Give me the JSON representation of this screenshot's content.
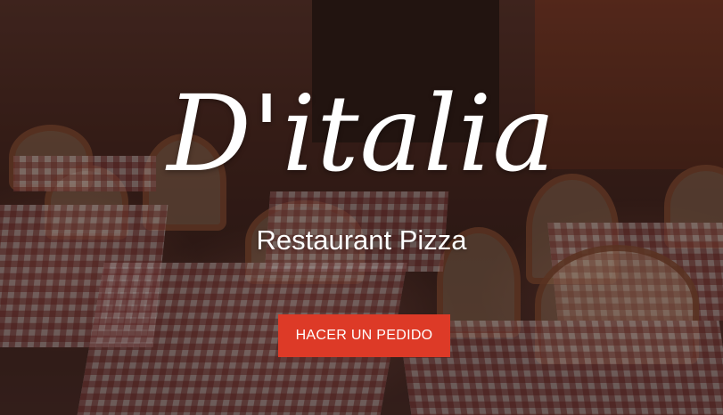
{
  "hero": {
    "brand": "D'italia",
    "tagline": "Restaurant Pizza",
    "cta_label": "HACER UN PEDIDO"
  },
  "colors": {
    "cta_background": "#dd3a27",
    "text": "#ffffff"
  }
}
